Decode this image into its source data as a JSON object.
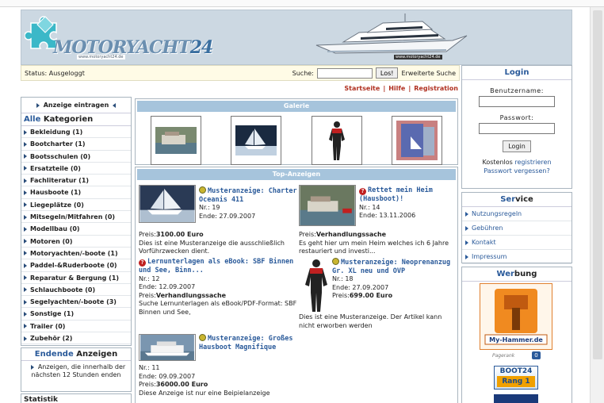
{
  "site": {
    "logo_text": "MOTORYACHT",
    "logo_number": "24",
    "logo_subtext": "www.motoryacht24.de",
    "yacht_caption": "www.motoryacht24.de"
  },
  "statusbar": {
    "status_text": "Status: Ausgeloggt",
    "search_label": "Suche:",
    "search_value": "",
    "search_button": "Los!",
    "extended_search": "Erweiterte Suche"
  },
  "nav": {
    "items": [
      "Startseite",
      "Hilfe",
      "Registration"
    ]
  },
  "left": {
    "post_ad": "Anzeige eintragen",
    "categories_head_1": "Alle",
    "categories_head_2": "Kategorien",
    "categories": [
      "Bekleidung (1)",
      "Bootcharter (1)",
      "Bootsschulen (0)",
      "Ersatzteile (0)",
      "Fachliteratur (1)",
      "Hausboote (1)",
      "Liegeplätze (0)",
      "Mitsegeln/Mitfahren (0)",
      "Modellbau (0)",
      "Motoren (0)",
      "Motoryachten/-boote (1)",
      "Paddel-&Ruderboote (0)",
      "Reparatur & Bergung (1)",
      "Schlauchboote (0)",
      "Segelyachten/-boote (3)",
      "Sonstige (1)",
      "Trailer (0)",
      "Zubehör (2)"
    ],
    "ending_head_1": "Endende",
    "ending_head_2": "Anzeigen",
    "ending_text": "Anzeigen, die innerhalb der nächsten 12 Stunden enden",
    "stats_head": "Statistik"
  },
  "gallery": {
    "title": "Galerie"
  },
  "top_ads": {
    "title": "Top-Anzeigen",
    "ads": [
      {
        "title": "Musteranzeige: Charter Oceanis 411",
        "nr": "Nr.: 19",
        "end": "Ende: 27.09.2007",
        "price_label": "Preis:",
        "price": "3100.00 Euro",
        "desc": "Dies ist eine Musteranzeige die ausschließlich Vorführzwecken dient."
      },
      {
        "title": "Rettet mein Heim (Hausboot)!",
        "nr": "Nr.: 14",
        "end": "Ende: 13.11.2006",
        "price_label": "Preis:",
        "price": "Verhandlungssache",
        "desc": "Es geht hier um mein Heim welches ich 6 Jahre restauriert und investi..."
      },
      {
        "title": "Lernunterlagen als eBook: SBF Binnen und See, Binn...",
        "nr": "Nr.: 12",
        "end": "Ende: 12.09.2007",
        "price_label": "Preis:",
        "price": "Verhandlungssache",
        "desc": "Suche Lernunterlagen als eBook/PDF-Format: SBF Binnen und See,"
      },
      {
        "title": "Musteranzeige: Neoprenanzug Gr. XL neu und OVP",
        "nr": "Nr.: 18",
        "end": "Ende: 27.09.2007",
        "price_label": "Preis:",
        "price": "699.00 Euro",
        "desc": "Dies ist eine Musteranzeige. Der Artikel kann nicht erworben werden"
      },
      {
        "title": "Musteranzeige: Großes Hausboot Magnifique",
        "nr": "Nr.: 11",
        "end": "Ende: 09.09.2007",
        "price_label": "Preis:",
        "price": "36000.00 Euro",
        "desc": "Diese Anzeige ist nur eine Beipielanzeige"
      }
    ]
  },
  "login": {
    "head": "Login",
    "username_label": "Benutzername:",
    "password_label": "Passwort:",
    "button": "Login",
    "free_text": "Kostenlos",
    "register_link": "registrieren",
    "forgot_link": "Passwort vergessen?"
  },
  "service": {
    "head_1": "Ser",
    "head_2": "vice",
    "items": [
      "Nutzungsregeln",
      "Gebühren",
      "Kontakt",
      "Impressum"
    ]
  },
  "werbung": {
    "head_1": "Wer",
    "head_2": "bung",
    "myhammer_text": "My-Hammer.de",
    "pagerank_label": "Pagerank",
    "pagerank_value": "0",
    "boot24_title": "BOOT24",
    "boot24_rank": "Rang 1"
  },
  "colors": {
    "bar": "#a6c4dc",
    "link": "#2a5a9a",
    "nav": "#b03020",
    "status_bg": "#fffbe6"
  }
}
